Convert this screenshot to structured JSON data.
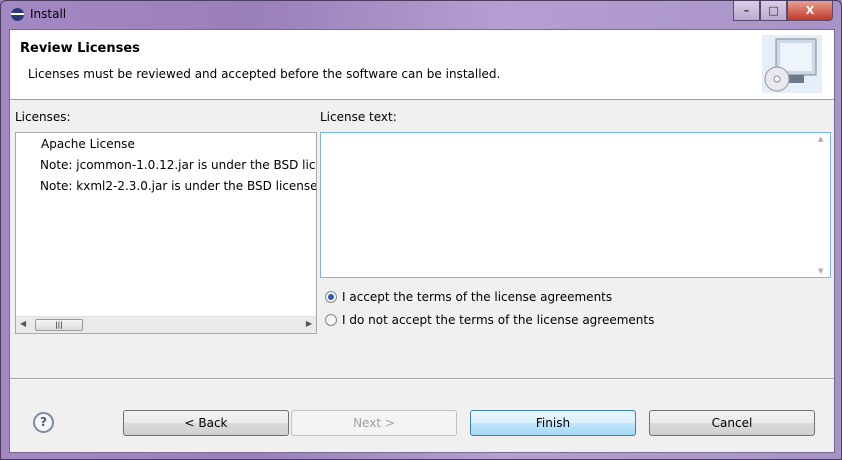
{
  "window": {
    "title": "Install",
    "minimize": "–",
    "maximize": "□",
    "close": "X"
  },
  "header": {
    "title": "Review Licenses",
    "description": "Licenses must be reviewed and accepted before the software can be installed."
  },
  "licenses": {
    "label": "Licenses:",
    "items": [
      "Apache License",
      "Note:  jcommon-1.0.12.jar is under the BSD lic",
      "Note:  kxml2-2.3.0.jar is under the BSD license"
    ]
  },
  "license_text": {
    "label": "License text:",
    "value": ""
  },
  "radios": [
    {
      "label": "I accept the terms of the license agreements",
      "checked": true
    },
    {
      "label": "I do not accept the terms of the license agreements",
      "checked": false
    }
  ],
  "buttons": {
    "back": "< Back",
    "next": "Next >",
    "finish": "Finish",
    "cancel": "Cancel",
    "help": "?"
  }
}
